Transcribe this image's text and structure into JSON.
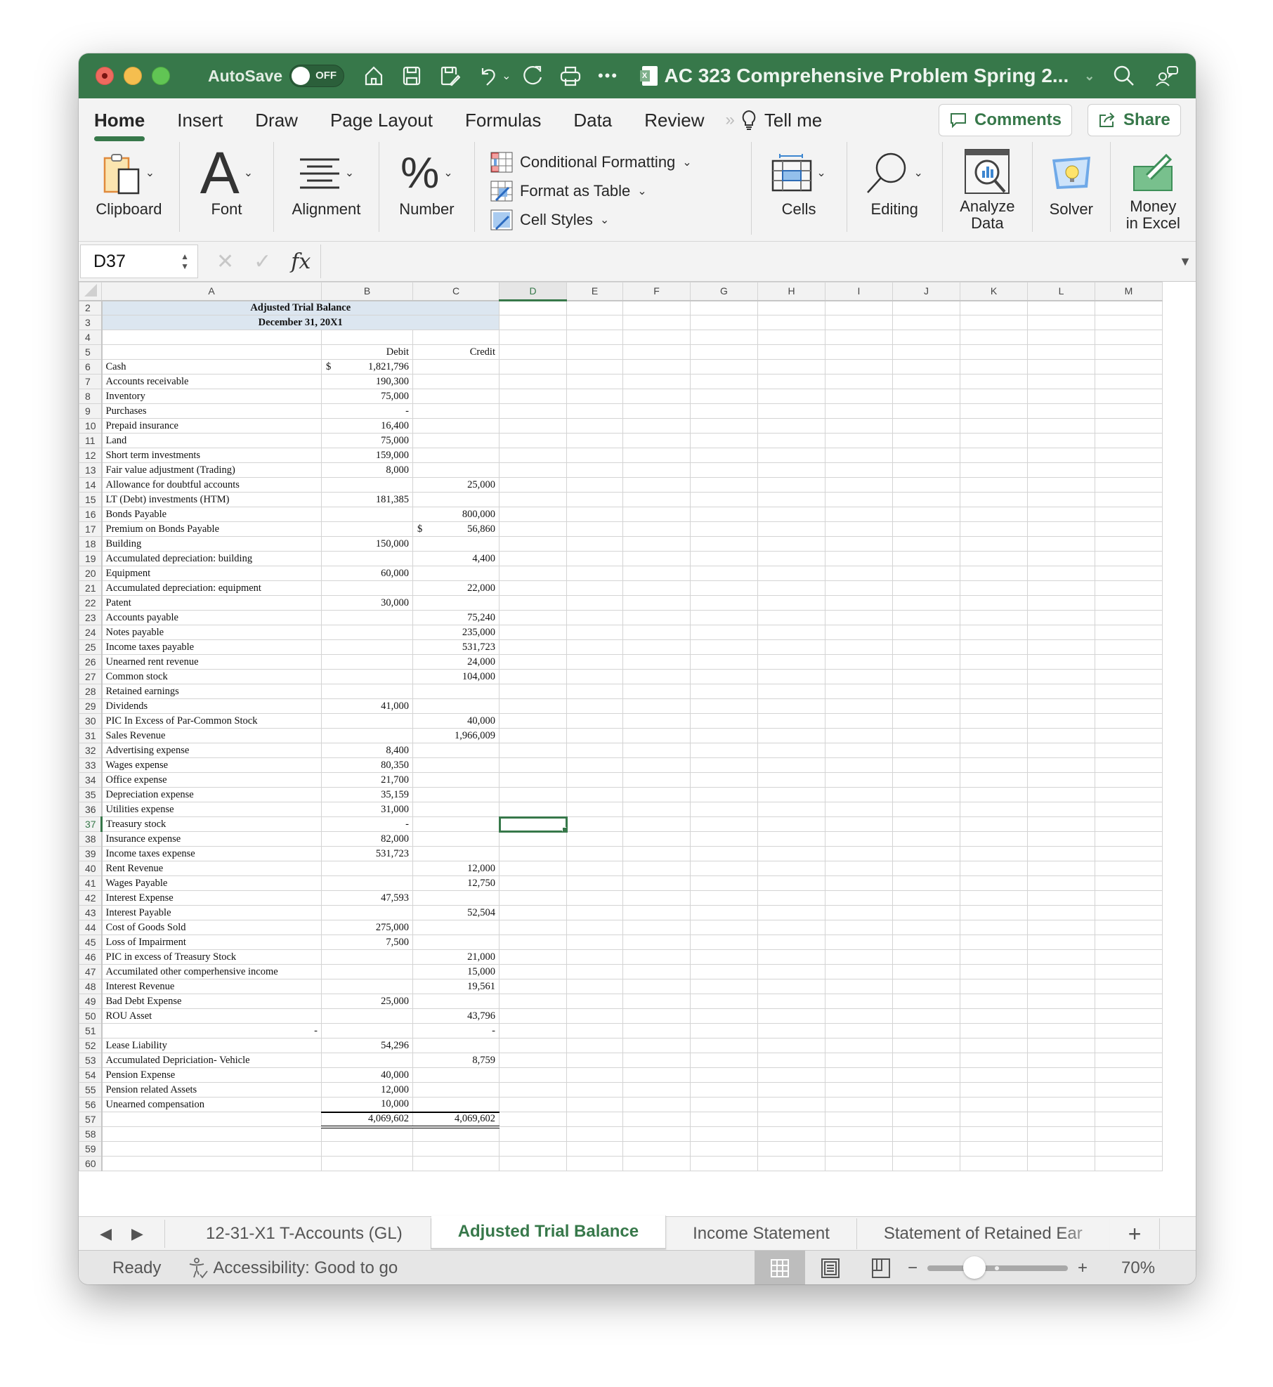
{
  "titlebar": {
    "autosave_label": "AutoSave",
    "autosave_state": "OFF",
    "document_title": "AC 323 Comprehensive Problem Spring 2...",
    "icons": [
      "home-icon",
      "save-icon",
      "save-as-icon",
      "undo-icon",
      "redo-icon",
      "print-icon",
      "more-icon",
      "search-icon",
      "collaborate-icon"
    ]
  },
  "ribbon_tabs": {
    "items": [
      "Home",
      "Insert",
      "Draw",
      "Page Layout",
      "Formulas",
      "Data",
      "Review"
    ],
    "active": "Home",
    "tell_me": "Tell me",
    "comments": "Comments",
    "share": "Share"
  },
  "ribbon": {
    "clipboard": "Clipboard",
    "font": "Font",
    "alignment": "Alignment",
    "number": "Number",
    "conditional_formatting": "Conditional Formatting",
    "format_as_table": "Format as Table",
    "cell_styles": "Cell Styles",
    "cells": "Cells",
    "editing": "Editing",
    "analyze_data_1": "Analyze",
    "analyze_data_2": "Data",
    "solver": "Solver",
    "money_1": "Money",
    "money_2": "in Excel"
  },
  "formula_bar": {
    "name_box": "D37",
    "fx": "fx",
    "formula": ""
  },
  "sheet": {
    "columns": [
      "A",
      "B",
      "C",
      "D",
      "E",
      "F",
      "G",
      "H",
      "I",
      "J",
      "K",
      "L",
      "M"
    ],
    "selected_column": "D",
    "selected_row": 37,
    "title_line1": "Adjusted Trial Balance",
    "title_line2": "December 31, 20X1",
    "debit_header": "Debit",
    "credit_header": "Credit",
    "rows": [
      {
        "r": 6,
        "account": "Cash",
        "debit": "1,821,796",
        "credit": "",
        "debit_dollar": "$"
      },
      {
        "r": 7,
        "account": "Accounts receivable",
        "debit": "190,300",
        "credit": ""
      },
      {
        "r": 8,
        "account": "Inventory",
        "debit": "75,000",
        "credit": ""
      },
      {
        "r": 9,
        "account": "Purchases",
        "debit": "-",
        "credit": ""
      },
      {
        "r": 10,
        "account": "Prepaid insurance",
        "debit": "16,400",
        "credit": ""
      },
      {
        "r": 11,
        "account": "Land",
        "debit": "75,000",
        "credit": ""
      },
      {
        "r": 12,
        "account": "Short term investments",
        "debit": "159,000",
        "credit": ""
      },
      {
        "r": 13,
        "account": "Fair value adjustment (Trading)",
        "debit": "8,000",
        "credit": ""
      },
      {
        "r": 14,
        "account": "Allowance for doubtful accounts",
        "debit": "",
        "credit": "25,000"
      },
      {
        "r": 15,
        "account": "LT (Debt) investments (HTM)",
        "debit": "181,385",
        "credit": ""
      },
      {
        "r": 16,
        "account": "Bonds Payable",
        "debit": "",
        "credit": "800,000"
      },
      {
        "r": 17,
        "account": "Premium on Bonds Payable",
        "debit": "",
        "credit": "56,860",
        "credit_dollar": "$"
      },
      {
        "r": 18,
        "account": "Building",
        "debit": "150,000",
        "credit": ""
      },
      {
        "r": 19,
        "account": "Accumulated depreciation: building",
        "debit": "",
        "credit": "4,400"
      },
      {
        "r": 20,
        "account": "Equipment",
        "debit": "60,000",
        "credit": ""
      },
      {
        "r": 21,
        "account": "Accumulated depreciation: equipment",
        "debit": "",
        "credit": "22,000"
      },
      {
        "r": 22,
        "account": "Patent",
        "debit": "30,000",
        "credit": ""
      },
      {
        "r": 23,
        "account": "Accounts payable",
        "debit": "",
        "credit": "75,240"
      },
      {
        "r": 24,
        "account": "Notes payable",
        "debit": "",
        "credit": "235,000"
      },
      {
        "r": 25,
        "account": "Income taxes payable",
        "debit": "",
        "credit": "531,723"
      },
      {
        "r": 26,
        "account": "Unearned rent revenue",
        "debit": "",
        "credit": "24,000"
      },
      {
        "r": 27,
        "account": "Common stock",
        "debit": "",
        "credit": "104,000"
      },
      {
        "r": 28,
        "account": "Retained earnings",
        "debit": "",
        "credit": ""
      },
      {
        "r": 29,
        "account": "Dividends",
        "debit": "41,000",
        "credit": ""
      },
      {
        "r": 30,
        "account": "PIC In Excess of Par-Common Stock",
        "debit": "",
        "credit": "40,000"
      },
      {
        "r": 31,
        "account": "Sales Revenue",
        "debit": "",
        "credit": "1,966,009"
      },
      {
        "r": 32,
        "account": "Advertising expense",
        "debit": "8,400",
        "credit": ""
      },
      {
        "r": 33,
        "account": "Wages expense",
        "debit": "80,350",
        "credit": ""
      },
      {
        "r": 34,
        "account": "Office expense",
        "debit": "21,700",
        "credit": ""
      },
      {
        "r": 35,
        "account": "Depreciation expense",
        "debit": "35,159",
        "credit": ""
      },
      {
        "r": 36,
        "account": "Utilities expense",
        "debit": "31,000",
        "credit": ""
      },
      {
        "r": 37,
        "account": "Treasury stock",
        "debit": "-",
        "credit": ""
      },
      {
        "r": 38,
        "account": "Insurance expense",
        "debit": "82,000",
        "credit": ""
      },
      {
        "r": 39,
        "account": "Income taxes expense",
        "debit": "531,723",
        "credit": ""
      },
      {
        "r": 40,
        "account": "Rent Revenue",
        "debit": "",
        "credit": "12,000"
      },
      {
        "r": 41,
        "account": "Wages Payable",
        "debit": "",
        "credit": "12,750"
      },
      {
        "r": 42,
        "account": "Interest Expense",
        "debit": "47,593",
        "credit": ""
      },
      {
        "r": 43,
        "account": "Interest Payable",
        "debit": "",
        "credit": "52,504"
      },
      {
        "r": 44,
        "account": "Cost of Goods Sold",
        "debit": "275,000",
        "credit": ""
      },
      {
        "r": 45,
        "account": "Loss of Impairment",
        "debit": "7,500",
        "credit": ""
      },
      {
        "r": 46,
        "account": "PIC in excess of Treasury Stock",
        "debit": "",
        "credit": "21,000"
      },
      {
        "r": 47,
        "account": "Accumilated other comperhensive income",
        "debit": "",
        "credit": "15,000"
      },
      {
        "r": 48,
        "account": "Interest Revenue",
        "debit": "",
        "credit": "19,561"
      },
      {
        "r": 49,
        "account": "Bad Debt Expense",
        "debit": "25,000",
        "credit": ""
      },
      {
        "r": 50,
        "account": "ROU Asset",
        "debit": "",
        "credit": "43,796"
      },
      {
        "r": 51,
        "account": "-",
        "debit": "",
        "credit": "-",
        "account_right": true
      },
      {
        "r": 52,
        "account": "Lease Liability",
        "debit": "54,296",
        "credit": ""
      },
      {
        "r": 53,
        "account": "Accumulated Depriciation- Vehicle",
        "debit": "",
        "credit": "8,759"
      },
      {
        "r": 54,
        "account": "Pension Expense",
        "debit": "40,000",
        "credit": ""
      },
      {
        "r": 55,
        "account": "Pension related Assets",
        "debit": "12,000",
        "credit": ""
      },
      {
        "r": 56,
        "account": "Unearned compensation",
        "debit": "10,000",
        "credit": ""
      }
    ],
    "totals": {
      "r": 57,
      "debit": "4,069,602",
      "credit": "4,069,602"
    },
    "trailing_rows": [
      58,
      59,
      60
    ]
  },
  "sheet_tabs": {
    "tabs": [
      "12-31-X1 T-Accounts (GL)",
      "Adjusted Trial Balance",
      "Income Statement",
      "Statement of Retained Ear"
    ],
    "active_index": 1,
    "add_label": "+"
  },
  "statusbar": {
    "ready": "Ready",
    "accessibility": "Accessibility: Good to go",
    "zoom_minus": "−",
    "zoom_plus": "+",
    "zoom_label": "70%",
    "zoom_percent": 70
  }
}
